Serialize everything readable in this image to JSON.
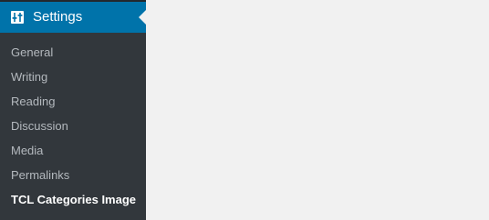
{
  "sidebar": {
    "settings_menu": {
      "label": "Settings",
      "icon": "settings-sliders-icon",
      "accent_color": "#0073aa"
    },
    "submenu": [
      {
        "label": "General"
      },
      {
        "label": "Writing"
      },
      {
        "label": "Reading"
      },
      {
        "label": "Discussion"
      },
      {
        "label": "Media"
      },
      {
        "label": "Permalinks"
      },
      {
        "label": "TCL Categories Image",
        "current": true
      }
    ],
    "colors": {
      "menu_background": "#23282d",
      "submenu_background": "#32373c",
      "submenu_text": "#b4b9be",
      "current_text": "#ffffff",
      "content_background": "#f1f1f1"
    }
  }
}
